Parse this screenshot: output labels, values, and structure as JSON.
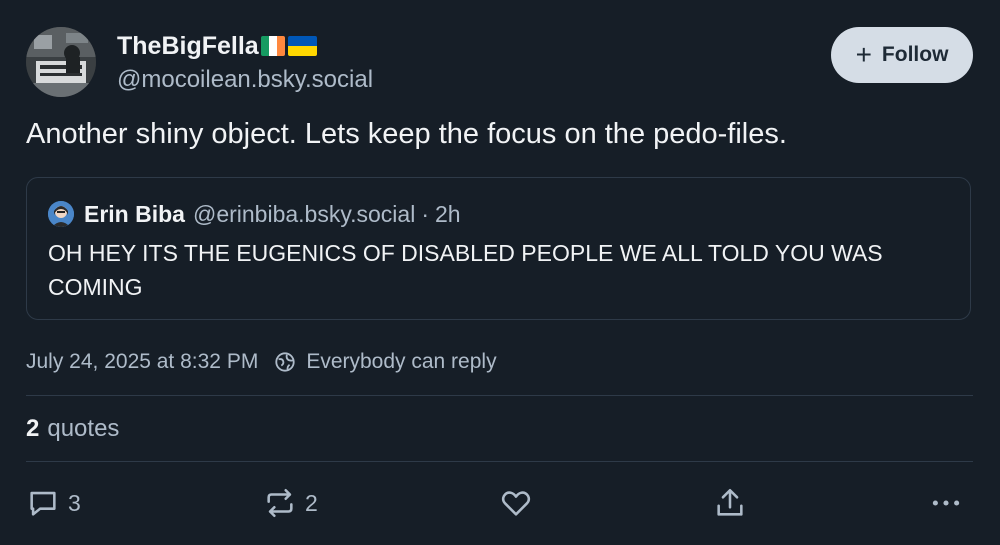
{
  "author": {
    "display_name": "TheBigFella",
    "handle": "@mocoilean.bsky.social"
  },
  "follow_button": {
    "label": "Follow"
  },
  "post": {
    "text": "Another shiny object. Lets keep the focus on the pedo-files."
  },
  "quoted_post": {
    "author_name": "Erin Biba",
    "author_handle": "@erinbiba.bsky.social",
    "separator": "·",
    "time_ago": "2h",
    "text": "OH HEY ITS THE EUGENICS OF DISABLED PEOPLE WE ALL TOLD YOU WAS COMING"
  },
  "meta": {
    "timestamp": "July 24, 2025 at 8:32 PM",
    "reply_setting": "Everybody can reply"
  },
  "stats": {
    "quotes_count": "2",
    "quotes_label": "quotes"
  },
  "actions": {
    "reply_count": "3",
    "repost_count": "2"
  },
  "colors": {
    "background": "#161e27",
    "text_primary": "#f1f3f5",
    "text_secondary": "#aebbc9",
    "border": "#2e3a48",
    "follow_bg": "#d5dde6"
  },
  "icons": [
    "plus-icon",
    "globe-icon",
    "reply-icon",
    "repost-icon",
    "like-icon",
    "share-icon",
    "more-icon"
  ]
}
